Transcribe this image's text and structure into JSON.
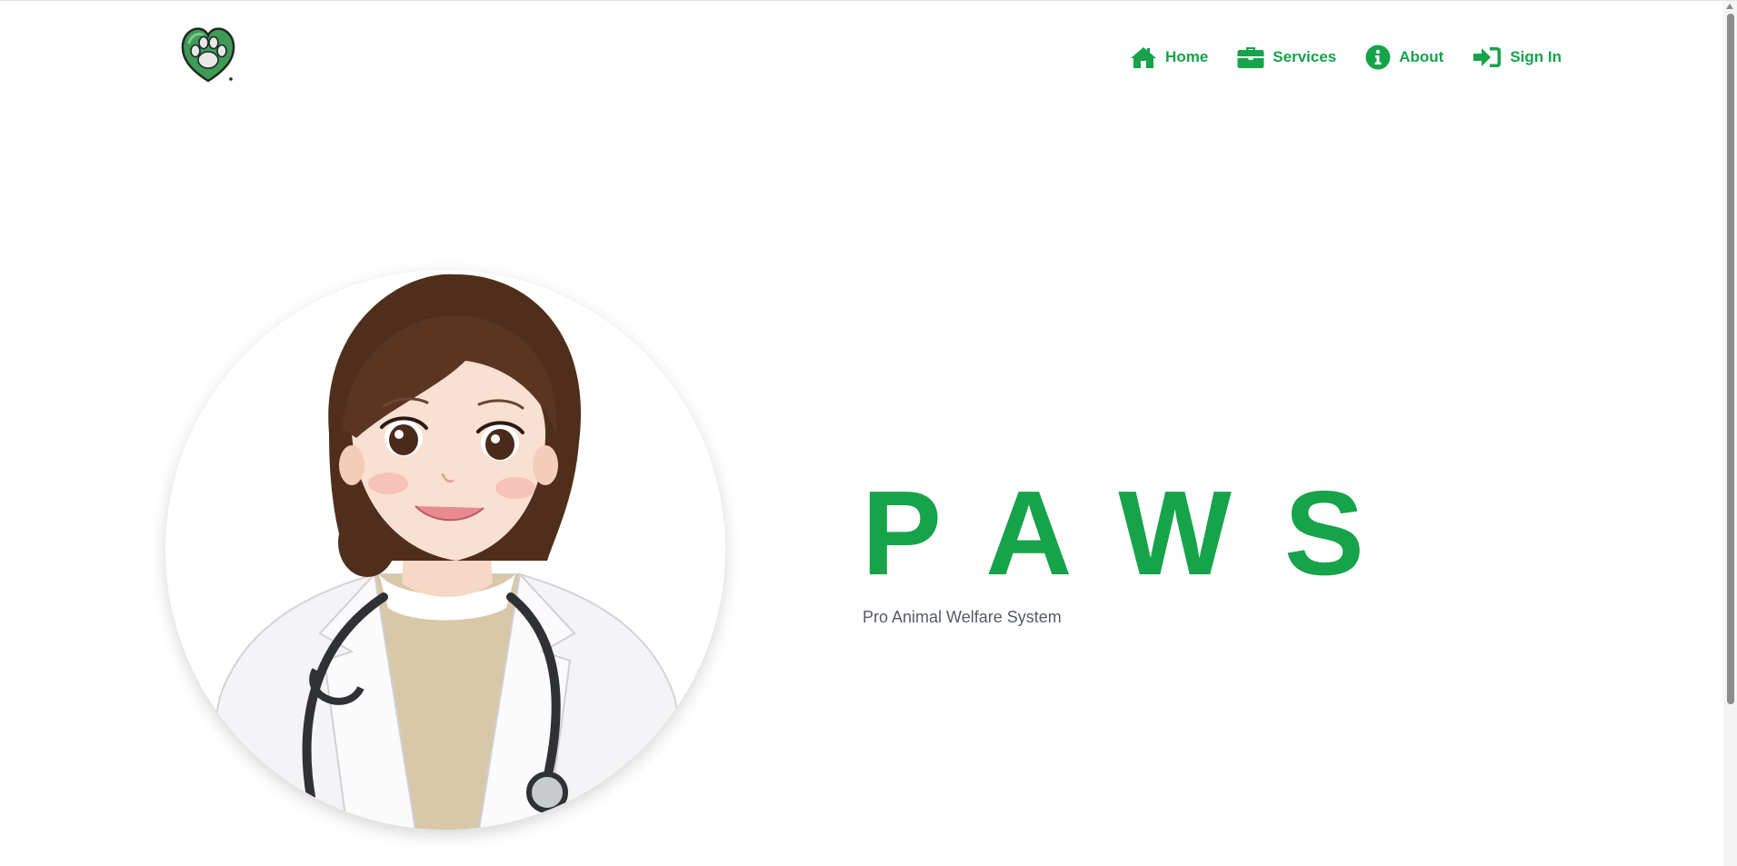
{
  "nav": {
    "items": [
      {
        "label": "Home",
        "icon": "home-icon"
      },
      {
        "label": "Services",
        "icon": "briefcase-icon"
      },
      {
        "label": "About",
        "icon": "info-icon"
      },
      {
        "label": "Sign In",
        "icon": "sign-in-icon"
      }
    ]
  },
  "hero": {
    "title": "PAWS",
    "subtitle": "Pro Animal Welfare System"
  },
  "colors": {
    "accent": "#16a34a",
    "subtitle": "#555b66"
  }
}
